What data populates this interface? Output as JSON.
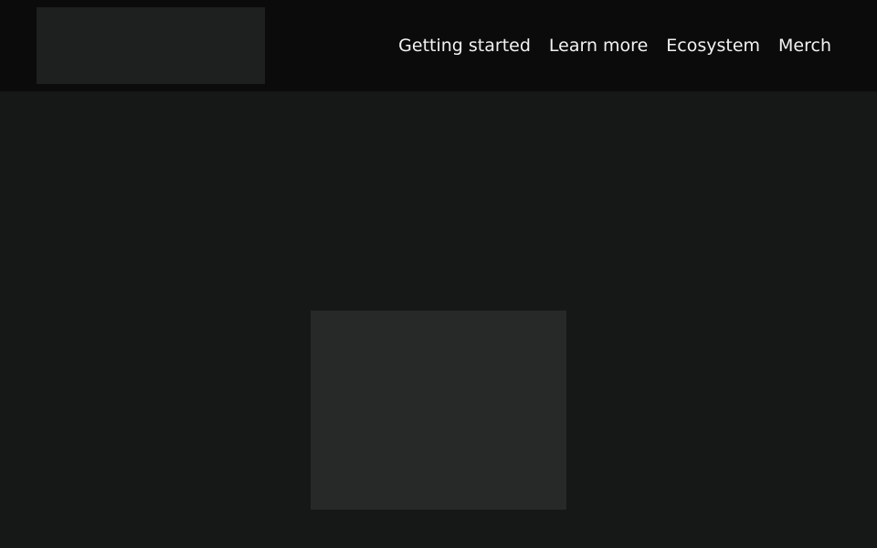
{
  "header": {
    "nav": [
      {
        "label": "Getting started"
      },
      {
        "label": "Learn more"
      },
      {
        "label": "Ecosystem"
      },
      {
        "label": "Merch"
      }
    ]
  }
}
